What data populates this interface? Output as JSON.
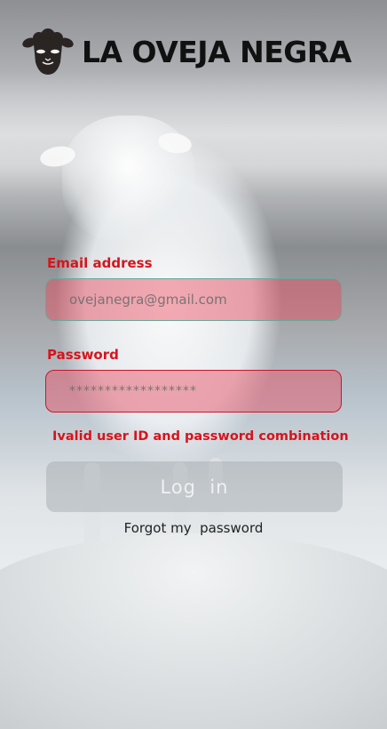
{
  "brand": {
    "title": "LA OVEJA NEGRA",
    "logo_icon": "black-sheep-icon"
  },
  "form": {
    "email_label": "Email address",
    "email_placeholder": "ovejanegra@gmail.com",
    "password_label": "Password",
    "password_value": "******************",
    "error_message": "Ivalid user ID and password combination",
    "login_label": "Log  in",
    "forgot_label": "Forgot my  password"
  },
  "colors": {
    "accent": "#d7141c",
    "field_fill": "#e8465a"
  }
}
